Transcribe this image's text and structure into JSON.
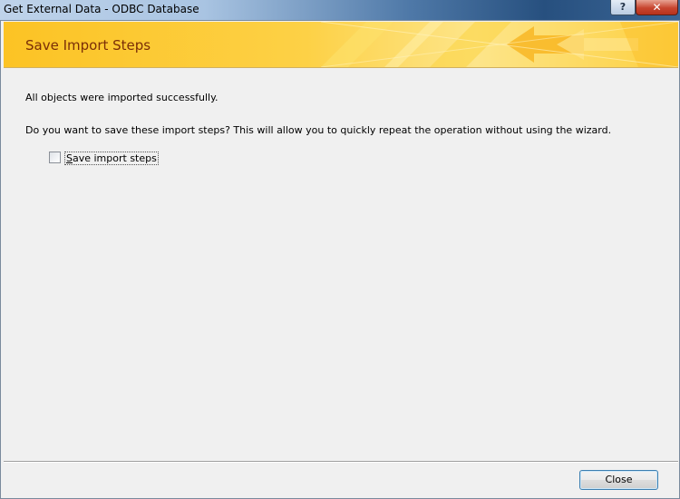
{
  "window": {
    "title": "Get External Data - ODBC Database",
    "help_icon": "?",
    "close_icon": "✕"
  },
  "banner": {
    "title": "Save Import Steps"
  },
  "main": {
    "message_success": "All objects were imported successfully.",
    "message_prompt": "Do you want to save these import steps? This will allow you to quickly repeat the operation without using the wizard.",
    "save_checkbox": {
      "label_accel": "S",
      "label_rest": "ave import steps",
      "checked": false
    }
  },
  "footer": {
    "close_label": "Close"
  },
  "colors": {
    "banner_title": "#7a2e07",
    "banner_yellow": "#fcc324",
    "button_border": "#3c7fb1"
  }
}
